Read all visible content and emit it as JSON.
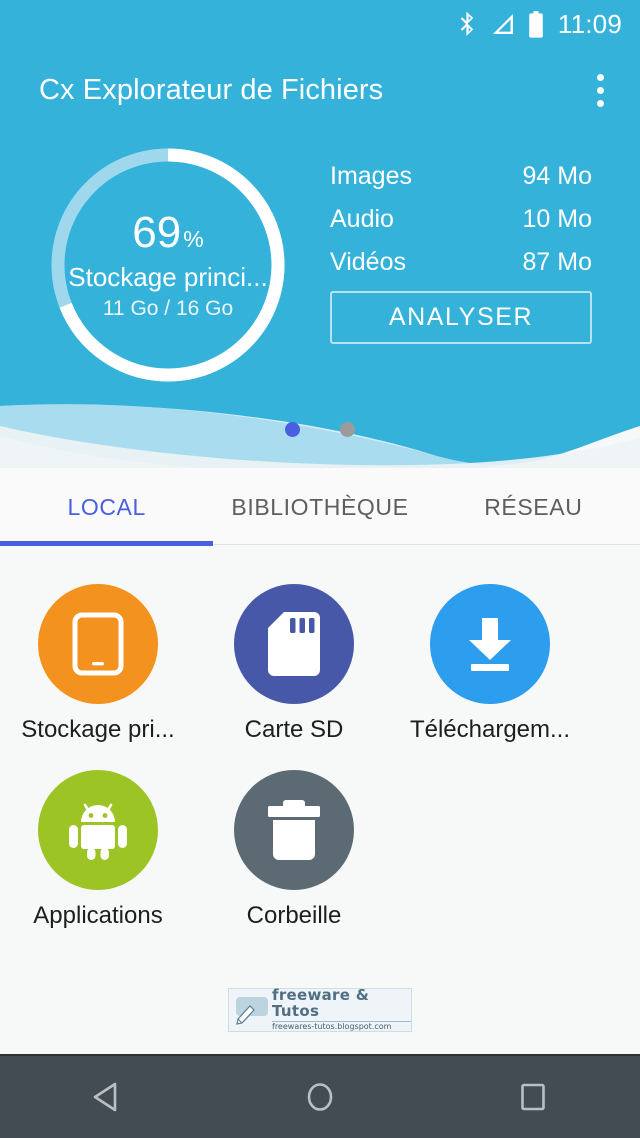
{
  "status_bar": {
    "time": "11:09",
    "icons": [
      "bluetooth-icon",
      "signal-icon",
      "battery-icon"
    ]
  },
  "app_bar": {
    "title": "Cx Explorateur de Fichiers",
    "overflow_icon": "more-vert-icon"
  },
  "storage": {
    "percent_value": "69",
    "percent_symbol": "%",
    "name": "Stockage princi...",
    "used_total": "11 Go / 16 Go",
    "percent_number": 69,
    "ring_color": "#ffffff",
    "ring_track_color": "#9fd8ec"
  },
  "stats": {
    "rows": [
      {
        "label": "Images",
        "value": "94 Mo"
      },
      {
        "label": "Audio",
        "value": "10 Mo"
      },
      {
        "label": "Vidéos",
        "value": "87 Mo"
      }
    ],
    "analyse_label": "ANALYSER"
  },
  "pager": {
    "dots": [
      {
        "state": "active",
        "color": "#4a5ee0"
      },
      {
        "state": "inactive",
        "color": "#9b9b9b"
      }
    ]
  },
  "tabs": {
    "items": [
      {
        "label": "LOCAL",
        "active": true
      },
      {
        "label": "BIBLIOTHÈQUE",
        "active": false
      },
      {
        "label": "RÉSEAU",
        "active": false
      }
    ],
    "active_color": "#4a5ee0",
    "inactive_color": "#5e5e5e"
  },
  "grid": {
    "items": [
      {
        "label": "Stockage pri...",
        "icon": "phone-icon",
        "color": "#f3921e"
      },
      {
        "label": "Carte SD",
        "icon": "sd-card-icon",
        "color": "#4858a8"
      },
      {
        "label": "Téléchargem...",
        "icon": "download-icon",
        "color": "#2d9ded"
      },
      {
        "label": "Applications",
        "icon": "android-icon",
        "color": "#9dc425"
      },
      {
        "label": "Corbeille",
        "icon": "trash-icon",
        "color": "#5c6b73"
      }
    ]
  },
  "watermark": {
    "title": "freeware & Tutos",
    "subtitle": "freewares-tutos.blogspot.com",
    "logo_icon": "pencil-bubble-icon"
  },
  "nav_bar": {
    "buttons": [
      {
        "name": "back",
        "icon": "back-triangle-icon"
      },
      {
        "name": "home",
        "icon": "home-circle-icon"
      },
      {
        "name": "recents",
        "icon": "recents-square-icon"
      }
    ]
  },
  "theme": {
    "primary": "#35b2da",
    "accent": "#4a5ee0",
    "background": "#f7f8f8",
    "nav_background": "#434c52"
  }
}
